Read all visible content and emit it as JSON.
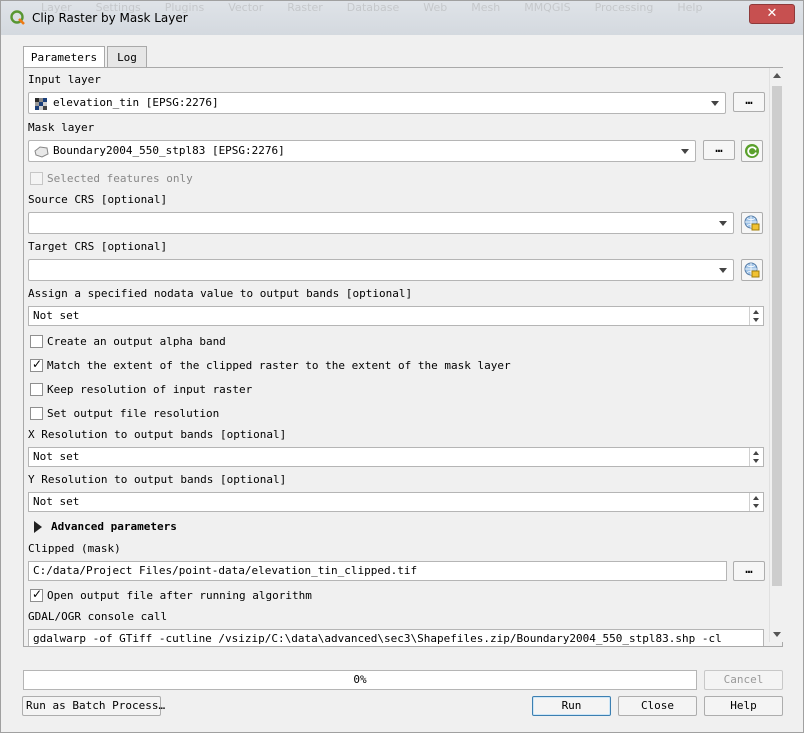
{
  "window": {
    "title": "Clip Raster by Mask Layer",
    "background_menu": [
      "Layer",
      "Settings",
      "Plugins",
      "Vector",
      "Raster",
      "Database",
      "Web",
      "Mesh",
      "MMQGIS",
      "Processing",
      "Help"
    ]
  },
  "tabs": [
    {
      "label": "Parameters",
      "active": true
    },
    {
      "label": "Log",
      "active": false
    }
  ],
  "params": {
    "input_layer": {
      "label": "Input layer",
      "value": "elevation_tin [EPSG:2276]",
      "icon": "raster-layer-icon"
    },
    "mask_layer": {
      "label": "Mask layer",
      "value": "Boundary2004_550_stpl83 [EPSG:2276]",
      "icon": "polygon-layer-icon"
    },
    "selected_only": {
      "label": "Selected features only",
      "checked": false,
      "enabled": false
    },
    "source_crs": {
      "label": "Source CRS [optional]",
      "value": ""
    },
    "target_crs": {
      "label": "Target CRS [optional]",
      "value": ""
    },
    "nodata": {
      "label": "Assign a specified nodata value to output bands [optional]",
      "value": "Not set"
    },
    "alpha_band": {
      "label": "Create an output alpha band",
      "checked": false
    },
    "match_extent": {
      "label": "Match the extent of the clipped raster to the extent of the mask layer",
      "checked": true
    },
    "keep_resolution": {
      "label": "Keep resolution of input raster",
      "checked": false
    },
    "set_resolution": {
      "label": "Set output file resolution",
      "checked": false
    },
    "x_res": {
      "label": "X Resolution to output bands [optional]",
      "value": "Not set"
    },
    "y_res": {
      "label": "Y Resolution to output bands [optional]",
      "value": "Not set"
    },
    "advanced": {
      "label": "Advanced parameters"
    },
    "clipped": {
      "label": "Clipped (mask)",
      "value": "C:/data/Project Files/point-data/elevation_tin_clipped.tif"
    },
    "open_after": {
      "label": "Open output file after running algorithm",
      "checked": true
    },
    "console": {
      "label": "GDAL/OGR console call",
      "value": "gdalwarp -of GTiff -cutline /vsizip/C:\\data\\advanced\\sec3\\Shapefiles.zip/Boundary2004_550_stpl83.shp -cl"
    }
  },
  "ellipsis_label": "…",
  "progress": {
    "text": "0%",
    "value": 0
  },
  "buttons": {
    "cancel": "Cancel",
    "batch": "Run as Batch Process…",
    "run": "Run",
    "close": "Close",
    "help": "Help"
  },
  "check_glyph": "✓"
}
